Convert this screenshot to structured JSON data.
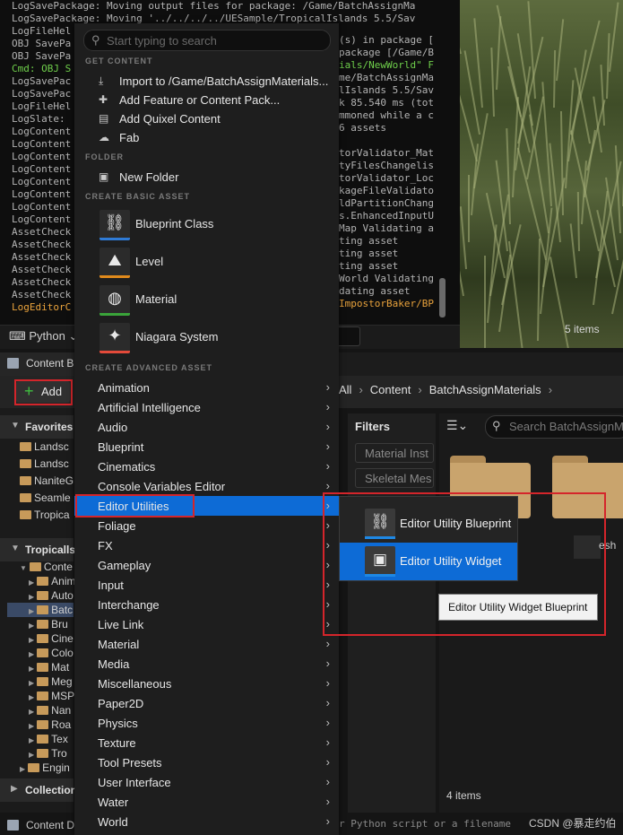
{
  "log_lines": [
    {
      "text": "LogSavePackage: Moving output files for package: /Game/BatchAssignMa",
      "style": "normal"
    },
    {
      "text": "LogSavePackage: Moving '../../../../UESample/TropicalIslands 5.5/Sav",
      "style": "normal"
    },
    {
      "text": "LogFileHel",
      "style": "normal"
    },
    {
      "text": "OBJ SavePa",
      "style": "normal"
    },
    {
      "text": "OBJ SavePa",
      "style": "normal"
    },
    {
      "text": "Cmd: OBJ S",
      "style": "green"
    },
    {
      "text": "LogSavePac",
      "style": "normal"
    },
    {
      "text": "LogSavePac",
      "style": "normal"
    },
    {
      "text": "LogFileHel",
      "style": "normal"
    },
    {
      "text": "LogSlate: ",
      "style": "normal"
    },
    {
      "text": "LogContent",
      "style": "normal"
    },
    {
      "text": "LogContent",
      "style": "normal"
    },
    {
      "text": "LogContent",
      "style": "normal"
    },
    {
      "text": "LogContent",
      "style": "normal"
    },
    {
      "text": "LogContent",
      "style": "normal"
    },
    {
      "text": "LogContent",
      "style": "normal"
    },
    {
      "text": "LogContent",
      "style": "normal"
    },
    {
      "text": "LogContent",
      "style": "normal"
    },
    {
      "text": "AssetCheck",
      "style": "normal"
    },
    {
      "text": "AssetCheck",
      "style": "normal"
    },
    {
      "text": "AssetCheck",
      "style": "normal"
    },
    {
      "text": "AssetCheck",
      "style": "normal"
    },
    {
      "text": "AssetCheck",
      "style": "normal"
    },
    {
      "text": "AssetCheck",
      "style": "normal"
    },
    {
      "text": "LogEditorC",
      "style": "orange"
    }
  ],
  "log_right": [
    {
      "text": "(s) in package [",
      "style": "normal"
    },
    {
      "text": "package [/Game/B",
      "style": "normal"
    },
    {
      "text": "ials/NewWorld\" F",
      "style": "green"
    },
    {
      "text": "me/BatchAssignMa",
      "style": "normal"
    },
    {
      "text": "lIslands 5.5/Sav",
      "style": "normal"
    },
    {
      "text": "k 85.540 ms (tot",
      "style": "normal"
    },
    {
      "text": "mmoned while a c",
      "style": "normal"
    },
    {
      "text": "6 assets",
      "style": "normal"
    },
    {
      "text": "",
      "style": "normal"
    },
    {
      "text": "torValidator_Mat",
      "style": "normal"
    },
    {
      "text": "tyFilesChangelis",
      "style": "normal"
    },
    {
      "text": "torValidator_Loc",
      "style": "normal"
    },
    {
      "text": "kageFileValidato",
      "style": "normal"
    },
    {
      "text": "ldPartitionChang",
      "style": "normal"
    },
    {
      "text": "s.EnhancedInputU",
      "style": "normal"
    },
    {
      "text": "Map Validating a",
      "style": "normal"
    },
    {
      "text": "ting asset",
      "style": "normal"
    },
    {
      "text": "ting asset",
      "style": "normal"
    },
    {
      "text": "ting asset",
      "style": "normal"
    },
    {
      "text": "World Validating",
      "style": "normal"
    },
    {
      "text": "dating asset",
      "style": "normal"
    },
    {
      "text": "ImpostorBaker/BP",
      "style": "orange"
    }
  ],
  "python_label": "Python",
  "viewport_items": "5 items",
  "content_browser_tab": "Content B",
  "add_label": "Add",
  "breadcrumb": [
    "All",
    "Content",
    "BatchAssignMaterials"
  ],
  "favorites_label": "Favorites",
  "favorites": [
    "Landsc",
    "Landsc",
    "NaniteG",
    "Seamle",
    "Tropica"
  ],
  "project_label": "Tropicalls",
  "tree": [
    "Conte",
    "Anim",
    "Auto",
    "Batc",
    "Bru",
    "Cine",
    "Colo",
    "Mat",
    "Meg",
    "MSP",
    "Nan",
    "Roa",
    "Tex",
    "Tro",
    "Engin"
  ],
  "collections_label": "Collection",
  "filters_label": "Filters",
  "filter_chips": [
    "Material Inst",
    "Skeletal Mes"
  ],
  "search_placeholder": "Search BatchAssignM",
  "items_count": "4 items",
  "thumb_text": "esh",
  "status_tab": "Content D",
  "python_status": "r Python script or a filename",
  "csdn": "CSDN @暴走约伯",
  "menu": {
    "search_placeholder": "Start typing to search",
    "get_content_header": "GET CONTENT",
    "get_content": [
      {
        "label": "Import to /Game/BatchAssignMaterials...",
        "icon": "import-icon"
      },
      {
        "label": "Add Feature or Content Pack...",
        "icon": "feature-pack-icon"
      },
      {
        "label": "Add Quixel Content",
        "icon": "quixel-icon"
      },
      {
        "label": "Fab",
        "icon": "fab-icon"
      }
    ],
    "folder_header": "FOLDER",
    "new_folder": "New Folder",
    "basic_header": "CREATE BASIC ASSET",
    "basic": [
      {
        "label": "Blueprint Class",
        "color": "#2f7bd6"
      },
      {
        "label": "Level",
        "color": "#e08a1c"
      },
      {
        "label": "Material",
        "color": "#3aa43a"
      },
      {
        "label": "Niagara System",
        "color": "#e34a3a"
      }
    ],
    "advanced_header": "CREATE ADVANCED ASSET",
    "advanced": [
      "Animation",
      "Artificial Intelligence",
      "Audio",
      "Blueprint",
      "Cinematics",
      "Console Variables Editor",
      "Editor Utilities",
      "Foliage",
      "FX",
      "Gameplay",
      "Input",
      "Interchange",
      "Live Link",
      "Material",
      "Media",
      "Miscellaneous",
      "Paper2D",
      "Physics",
      "Texture",
      "Tool Presets",
      "User Interface",
      "Water",
      "World"
    ],
    "selected_index": 6
  },
  "submenu": [
    {
      "label": "Editor Utility Blueprint",
      "selected": false
    },
    {
      "label": "Editor Utility Widget",
      "selected": true
    }
  ],
  "tooltip": "Editor Utility Widget Blueprint",
  "colors": {
    "accent": "#0d6bd6",
    "highlight_box": "#d4252b"
  }
}
